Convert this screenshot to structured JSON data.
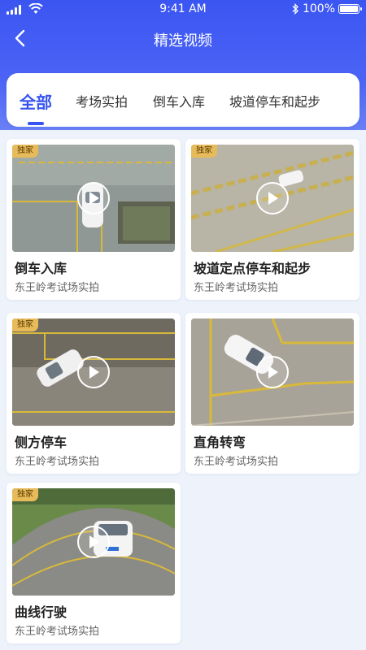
{
  "status_bar": {
    "time": "9:41 AM",
    "battery": "100%",
    "battery_level": 1.0
  },
  "header": {
    "title": "精选视频",
    "back_icon": "chevron-left-icon"
  },
  "tabs": [
    {
      "label": "全部",
      "active": true
    },
    {
      "label": "考场实拍",
      "active": false
    },
    {
      "label": "倒车入库",
      "active": false
    },
    {
      "label": "坡道停车和起步",
      "active": false
    }
  ],
  "videos": [
    {
      "badge": "独家",
      "title": "倒车入库",
      "subtitle": "东王岭考试场实拍"
    },
    {
      "badge": "独家",
      "title": "坡道定点停车和起步",
      "subtitle": "东王岭考试场实拍"
    },
    {
      "badge": "独家",
      "title": "侧方停车",
      "subtitle": "东王岭考试场实拍"
    },
    {
      "badge": "",
      "title": "直角转弯",
      "subtitle": "东王岭考试场实拍"
    },
    {
      "badge": "独家",
      "title": "曲线行驶",
      "subtitle": "东王岭考试场实拍"
    }
  ],
  "colors": {
    "primary": "#3554f2",
    "badge": "#e7bb5a",
    "background": "#eef3fb"
  }
}
